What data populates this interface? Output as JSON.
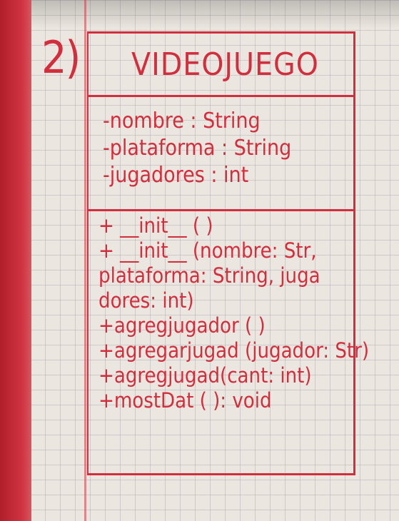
{
  "exercise_number": "2)",
  "class_name": "VIDEOJUEGO",
  "attributes": [
    "-nombre : String",
    "-plataforma : String",
    "-jugadores : int"
  ],
  "methods": [
    "+ __init__ ( )",
    "+ __init__ (nombre: Str,",
    "plataforma: String, juga",
    "dores: int)",
    "+agregjugador ( )",
    "+agregarjugad (jugador: Str)",
    "+agregjugad(cant: int)",
    "+mostDat ( ): void"
  ],
  "colors": {
    "ink": "#d12e3e",
    "binding": "#cf3340",
    "paper": "#ebe6df"
  }
}
